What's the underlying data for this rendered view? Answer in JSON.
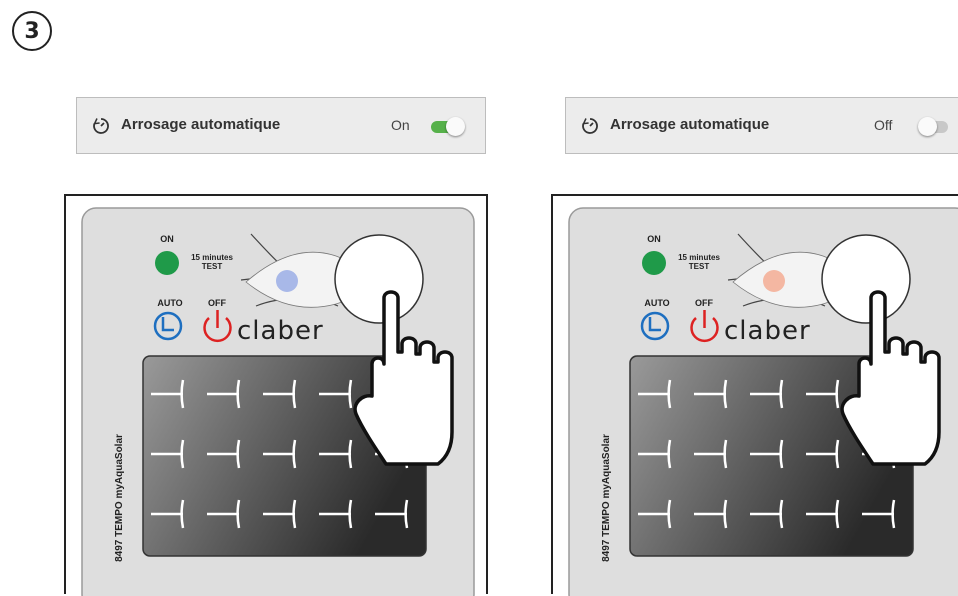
{
  "step": {
    "number": "3"
  },
  "panels": [
    {
      "toggle": {
        "label": "Arrosage automatique",
        "state_text": "On",
        "switch_on": true,
        "switch_color": "#56b14a"
      },
      "device": {
        "on_label": "ON",
        "test_label_line1": "15 minutes",
        "test_label_line2": "TEST",
        "auto_label": "AUTO",
        "off_label": "OFF",
        "brand": "claber",
        "model": "8497 TEMPO myAquaSolar",
        "led_color": "#a8b8e8"
      }
    },
    {
      "toggle": {
        "label": "Arrosage automatique",
        "state_text": "Off",
        "switch_on": false,
        "switch_color": "#c8c8c8"
      },
      "device": {
        "on_label": "ON",
        "test_label_line1": "15 minutes",
        "test_label_line2": "TEST",
        "auto_label": "AUTO",
        "off_label": "OFF",
        "brand": "claber",
        "model": "8497 TEMPO myAquaSolar",
        "led_color": "#f4b7a2"
      }
    }
  ],
  "icons": {
    "timer": "timer-icon",
    "clock": "clock-icon",
    "power": "power-icon",
    "hand": "pointing-hand-icon"
  }
}
